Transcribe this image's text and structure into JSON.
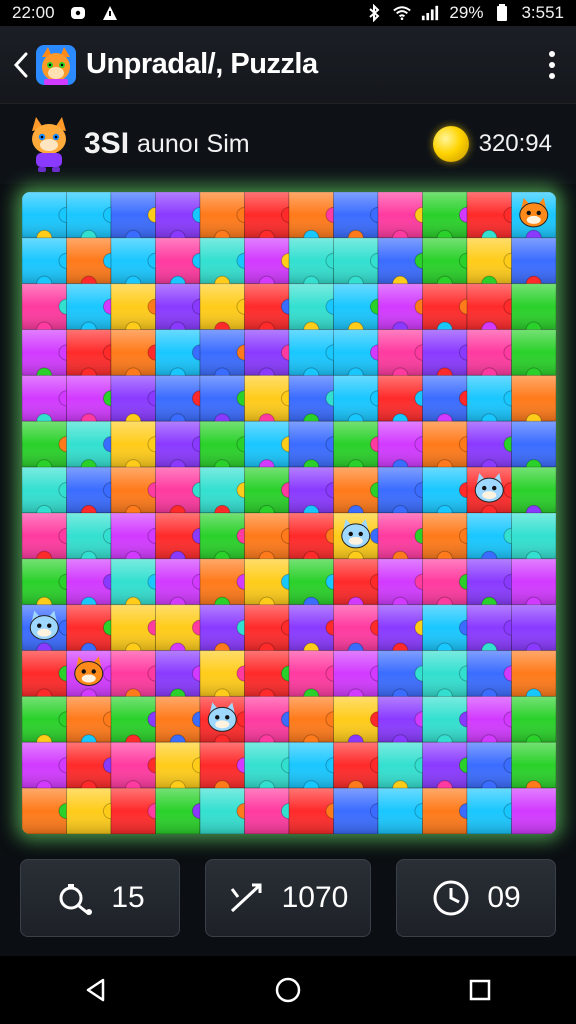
{
  "status_bar": {
    "time": "22:00",
    "battery": "29%",
    "clock_right": "3:551"
  },
  "app_bar": {
    "title": "Unpradal/, Puzzla",
    "back_icon": "chevron-left-icon",
    "menu_icon": "kebab-menu-icon"
  },
  "score": {
    "value": "3SI",
    "label": "aunoı Sim",
    "coins": "320:94"
  },
  "board": {
    "cols": 12,
    "rows": 14,
    "palette": [
      "#ff2a2a",
      "#ff7a1a",
      "#ffcc1a",
      "#2ad12a",
      "#19c7ff",
      "#3a6cff",
      "#8a3aff",
      "#d23aff",
      "#33e0d0",
      "#ff3aa0"
    ],
    "mascots": [
      {
        "col": 11,
        "row": 0,
        "kind": "fox"
      },
      {
        "col": 10,
        "row": 6,
        "kind": "cat"
      },
      {
        "col": 7,
        "row": 7,
        "kind": "cat"
      },
      {
        "col": 0,
        "row": 9,
        "kind": "cat"
      },
      {
        "col": 1,
        "row": 10,
        "kind": "fox"
      },
      {
        "col": 4,
        "row": 11,
        "kind": "cat"
      }
    ]
  },
  "tools": [
    {
      "icon": "hint-icon",
      "value": "15"
    },
    {
      "icon": "magic-wand-icon",
      "value": "1070"
    },
    {
      "icon": "timer-icon",
      "value": "09"
    }
  ],
  "nav": {
    "back": "triangle-back-icon",
    "home": "circle-home-icon",
    "recents": "square-recents-icon"
  }
}
